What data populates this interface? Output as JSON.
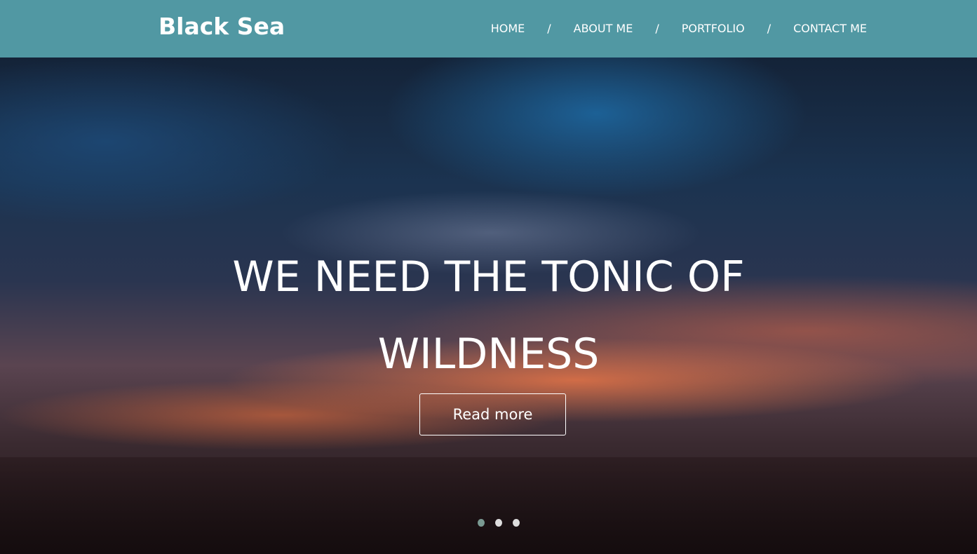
{
  "header": {
    "logo": "Black Sea",
    "nav": [
      "HOME",
      "ABOUT ME",
      "PORTFOLIO",
      "CONTACT ME"
    ],
    "separator": "/"
  },
  "hero": {
    "title_line1": "WE NEED THE TONIC OF",
    "title_line2": "WILDNESS",
    "button": "Read more",
    "slides": 3,
    "active_slide": 1
  },
  "colors": {
    "header": "#5198a3",
    "active_dot": "#7a9a92"
  }
}
